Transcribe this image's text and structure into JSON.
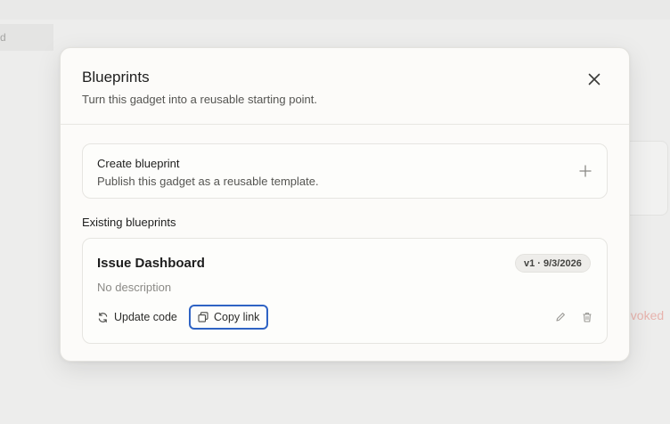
{
  "background": {
    "field_text": "d",
    "status_text": "evoked"
  },
  "modal": {
    "title": "Blueprints",
    "subtitle": "Turn this gadget into a reusable starting point.",
    "close_icon": "close-icon",
    "create": {
      "title": "Create blueprint",
      "description": "Publish this gadget as a reusable template.",
      "icon": "plus-icon"
    },
    "existing_label": "Existing blueprints",
    "blueprints": [
      {
        "name": "Issue Dashboard",
        "version": "v1 · 9/3/2026",
        "description": "No description",
        "update_label": "Update code",
        "copy_label": "Copy link",
        "icons": [
          "refresh-icon",
          "copy-icon",
          "pencil-icon",
          "trash-icon"
        ]
      }
    ]
  },
  "colors": {
    "focus_ring": "#2f63c4",
    "modal_bg": "#fcfbf9",
    "overlay_bg": "#ededec",
    "revoked_text": "#e7b3ad"
  }
}
